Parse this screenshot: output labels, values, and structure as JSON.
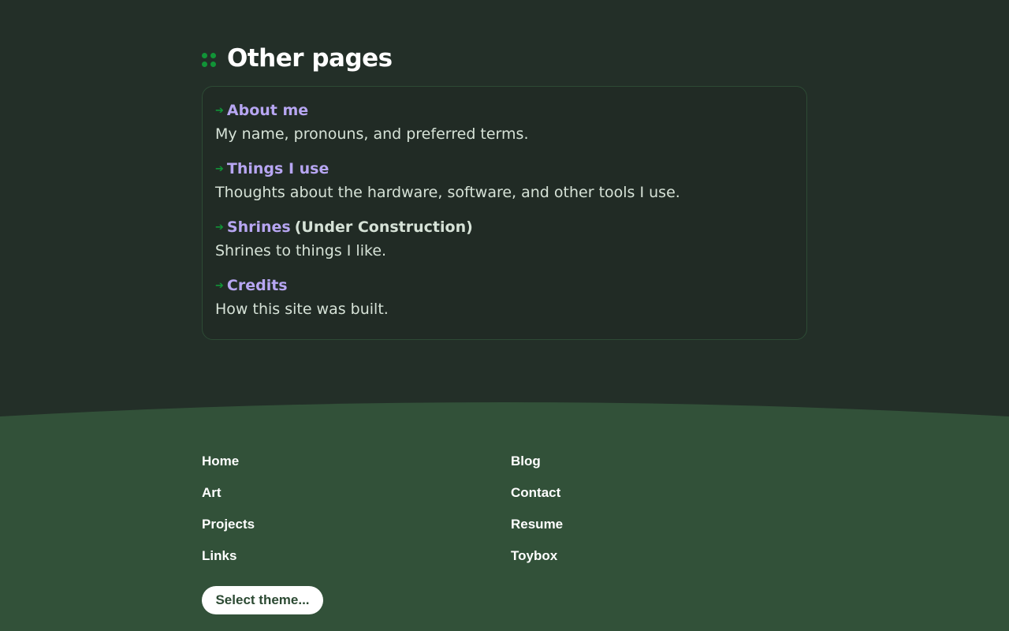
{
  "section": {
    "title": "Other pages",
    "items": [
      {
        "title": "About me",
        "suffix": "",
        "description": "My name, pronouns, and preferred terms."
      },
      {
        "title": "Things I use",
        "suffix": "",
        "description": "Thoughts about the hardware, software, and other tools I use."
      },
      {
        "title": "Shrines",
        "suffix": "(Under Construction)",
        "description": "Shrines to things I like."
      },
      {
        "title": "Credits",
        "suffix": "",
        "description": "How this site was built."
      }
    ]
  },
  "footer": {
    "links": [
      {
        "label": "Home"
      },
      {
        "label": "Blog"
      },
      {
        "label": "Art"
      },
      {
        "label": "Contact"
      },
      {
        "label": "Projects"
      },
      {
        "label": "Resume"
      },
      {
        "label": "Links"
      },
      {
        "label": "Toybox"
      }
    ],
    "theme_button_label": "Select theme..."
  },
  "colors": {
    "background": "#232f28",
    "footer_background": "#325139",
    "accent_green": "#119437",
    "link_purple": "#b7a6f2",
    "text": "#d6e2d7"
  },
  "icons": {
    "heading": "grip-dots-icon",
    "item_bullet": "arrow-right-icon"
  }
}
